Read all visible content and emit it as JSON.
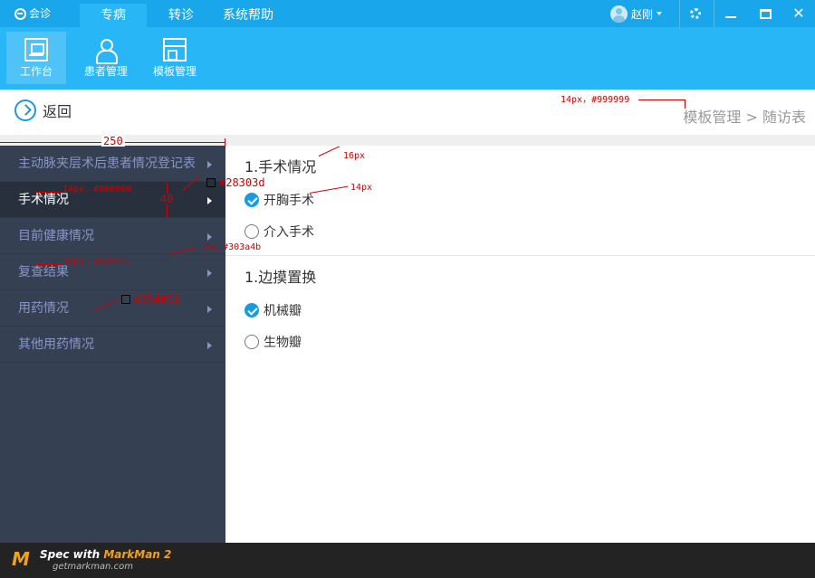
{
  "app": {
    "logo_text": "会诊"
  },
  "nav": {
    "tabs": [
      {
        "label": "专病",
        "active": true
      },
      {
        "label": "转诊"
      },
      {
        "label": "系统帮助"
      }
    ]
  },
  "user": {
    "name": "赵刚"
  },
  "toolbar": {
    "items": [
      {
        "label": "工作台",
        "icon": "desk-icon",
        "active": true
      },
      {
        "label": "患者管理",
        "icon": "patient-icon"
      },
      {
        "label": "模板管理",
        "icon": "template-icon"
      }
    ]
  },
  "breadcrumb": {
    "back_label": "返回",
    "parent": "模板管理",
    "separator": ">",
    "current": "随访表"
  },
  "sidebar": {
    "items": [
      {
        "label": "主动脉夹层术后患者情况登记表"
      },
      {
        "label": "手术情况",
        "active": true
      },
      {
        "label": "目前健康情况"
      },
      {
        "label": "复查结果"
      },
      {
        "label": "用药情况"
      },
      {
        "label": "其他用药情况"
      }
    ]
  },
  "content": {
    "sections": [
      {
        "title": "1.手术情况",
        "options": [
          {
            "label": "开胸手术",
            "checked": true
          },
          {
            "label": "介入手术",
            "checked": false
          }
        ]
      },
      {
        "title": "1.边摸置换",
        "options": [
          {
            "label": "机械瓣",
            "checked": true
          },
          {
            "label": "生物瓣",
            "checked": false
          }
        ]
      }
    ]
  },
  "annotations": {
    "crumb_spec": "14px，#999999",
    "sidebar_width": "250",
    "title_size": "16px",
    "option_size": "14px",
    "active_spec": "14px，#000000",
    "row_height": "40",
    "active_bg": "#28303d",
    "divider_spec": "1px，#303a4b",
    "item_spec": "14px，#8a95c7",
    "sidebar_bg": "#354052"
  },
  "colors": {
    "accent": "#1a9be0",
    "topbar": "#1aa6ea",
    "toolbar": "#29b6f6",
    "sidebar_bg": "#354052",
    "sidebar_active": "#28303d",
    "sidebar_text": "#8a95c7"
  },
  "footer": {
    "brand_mark": "M",
    "spec_prefix": "Spec with",
    "spec_brand": "MarkMan 2",
    "url": "getmarkman.com"
  }
}
